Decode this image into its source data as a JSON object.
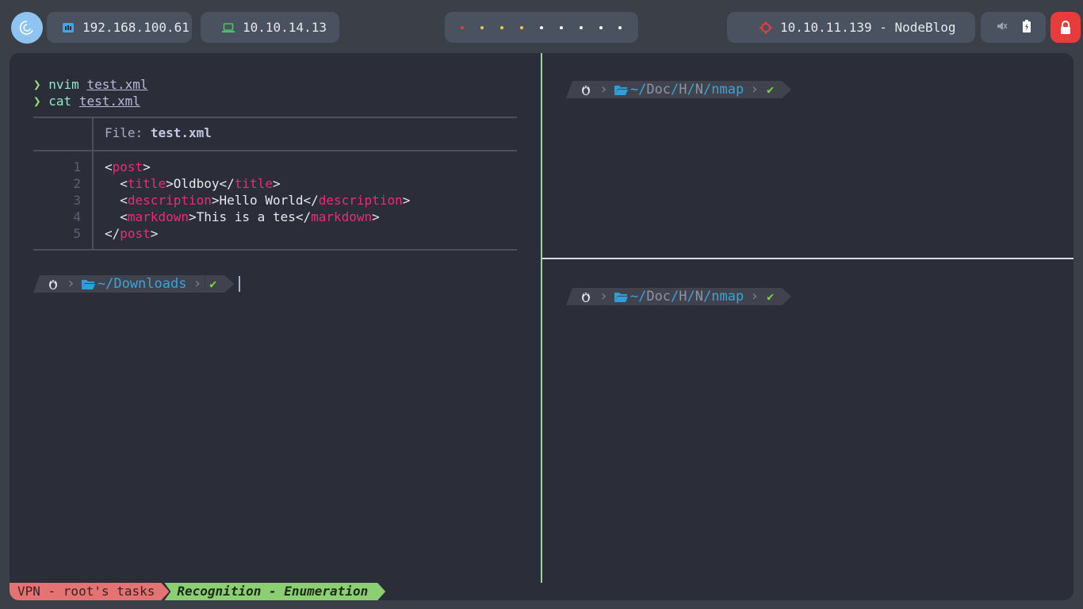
{
  "topbar": {
    "launcher_icon": "debian-swirl-icon",
    "local_ip": "192.168.100.61",
    "vpn_ip": "10.10.14.13",
    "workspace_count": 9,
    "target": "10.10.11.139 - NodeBlog",
    "volume_icon": "volume-muted-icon",
    "battery_icon": "battery-charging-icon",
    "lock_icon": "lock-icon",
    "colors": {
      "accent_red": "#e83b3b",
      "workspace_active": "#e83b3b",
      "workspace_occupied": "#f0c34a"
    }
  },
  "left_pane": {
    "history": [
      {
        "symbol": "❯",
        "command": "nvim",
        "argument": "test.xml"
      },
      {
        "symbol": "❯",
        "command": "cat",
        "argument": "test.xml"
      }
    ],
    "file_header_label": "File:",
    "file_name": "test.xml",
    "line_numbers": [
      "1",
      "2",
      "3",
      "4",
      "5"
    ],
    "code": [
      {
        "indent": "",
        "open": "post",
        "text": "",
        "close": ""
      },
      {
        "indent": "  ",
        "open": "title",
        "text": "Oldboy",
        "close": "title"
      },
      {
        "indent": "  ",
        "open": "description",
        "text": "Hello World",
        "close": "description"
      },
      {
        "indent": "  ",
        "open": "markdown",
        "text": "This is a tes",
        "close": "markdown"
      },
      {
        "indent": "",
        "open": "",
        "text": "",
        "close": "post"
      }
    ],
    "prompt": {
      "dir_prefix": "~/",
      "dir_name": "Downloads",
      "status": "✔"
    }
  },
  "right_top_pane": {
    "prompt": {
      "dir_prefix": "~/",
      "dir_parts": [
        "Doc",
        "H",
        "N"
      ],
      "dir_name": "nmap",
      "status": "✔"
    }
  },
  "right_bottom_pane": {
    "prompt": {
      "dir_prefix": "~/",
      "dir_parts": [
        "Doc",
        "H",
        "N"
      ],
      "dir_name": "nmap",
      "status": "✔"
    }
  },
  "status_bar": {
    "session": "VPN - root's tasks",
    "window": "Recognition - Enumeration"
  }
}
